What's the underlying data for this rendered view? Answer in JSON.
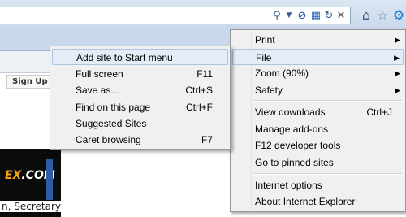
{
  "address_bar": {
    "icons": [
      "search-icon",
      "dropdown-arrow-icon",
      "compatibility-icon",
      "rss-icon",
      "refresh-icon",
      "stop-icon"
    ]
  },
  "toolbar": {
    "icons": [
      "home-icon",
      "favorites-star-icon",
      "tools-gear-icon"
    ]
  },
  "page": {
    "signup_label": "Sign Up F",
    "ad_logo_left": "EX",
    "ad_logo_right": ".COM",
    "news_snippet": "n, Secretary"
  },
  "tools_menu": {
    "items": [
      {
        "label": "Print",
        "has_submenu": true
      },
      {
        "label": "File",
        "has_submenu": true,
        "highlighted": true
      },
      {
        "label": "Zoom (90%)",
        "has_submenu": true
      },
      {
        "label": "Safety",
        "has_submenu": true
      },
      {
        "label": "View downloads",
        "shortcut": "Ctrl+J"
      },
      {
        "label": "Manage add-ons"
      },
      {
        "label": "F12 developer tools"
      },
      {
        "label": "Go to pinned sites"
      },
      {
        "label": "Internet options"
      },
      {
        "label": "About Internet Explorer"
      }
    ]
  },
  "file_submenu": {
    "items": [
      {
        "label": "Add site to Start menu",
        "highlighted": true
      },
      {
        "label": "Full screen",
        "shortcut": "F11"
      },
      {
        "label": "Save as...",
        "shortcut": "Ctrl+S"
      },
      {
        "label": "Find on this page",
        "shortcut": "Ctrl+F"
      },
      {
        "label": "Suggested Sites"
      },
      {
        "label": "Caret browsing",
        "shortcut": "F7"
      }
    ]
  },
  "colors": {
    "chrome": "#c9d8ea",
    "menu_bg": "#f0f0f0",
    "highlight": "#e3ecf7",
    "gear_blue": "#2d7fd3"
  }
}
